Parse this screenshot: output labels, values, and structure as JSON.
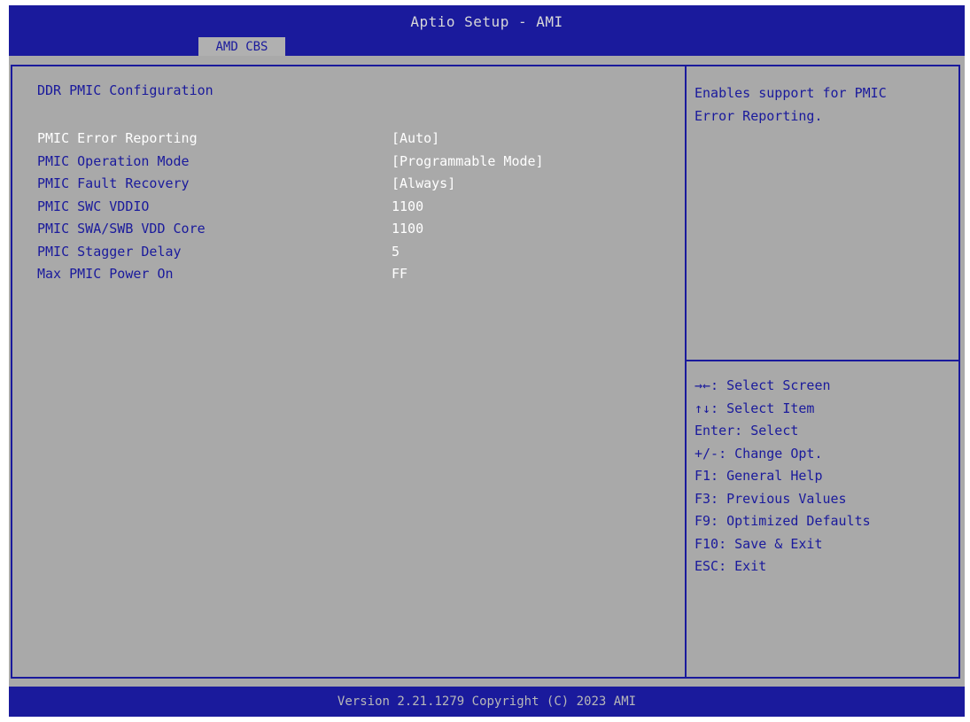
{
  "header": {
    "title": "Aptio Setup - AMI",
    "tab": "AMD CBS"
  },
  "page": {
    "title": "DDR PMIC Configuration"
  },
  "settings": [
    {
      "label": "PMIC Error Reporting",
      "value": "[Auto]"
    },
    {
      "label": "PMIC Operation Mode",
      "value": "[Programmable Mode]"
    },
    {
      "label": "PMIC Fault Recovery",
      "value": "[Always]"
    },
    {
      "label": "PMIC SWC VDDIO",
      "value": "1100"
    },
    {
      "label": "PMIC SWA/SWB VDD Core",
      "value": "1100"
    },
    {
      "label": "PMIC Stagger Delay",
      "value": "5"
    },
    {
      "label": "Max PMIC Power On",
      "value": "FF"
    }
  ],
  "help": {
    "lines": [
      "Enables support for PMIC",
      "Error Reporting."
    ]
  },
  "keys": [
    "→←: Select Screen",
    "↑↓: Select Item",
    "Enter: Select",
    "+/-: Change Opt.",
    "F1: General Help",
    "F3: Previous Values",
    "F9: Optimized Defaults",
    "F10: Save & Exit",
    "ESC: Exit"
  ],
  "footer": {
    "version": "Version 2.21.1279 Copyright (C) 2023 AMI"
  },
  "colors": {
    "header_blue": "#1a1a9c",
    "panel_gray": "#a9a9a9",
    "selected_text": "#ffffff"
  }
}
